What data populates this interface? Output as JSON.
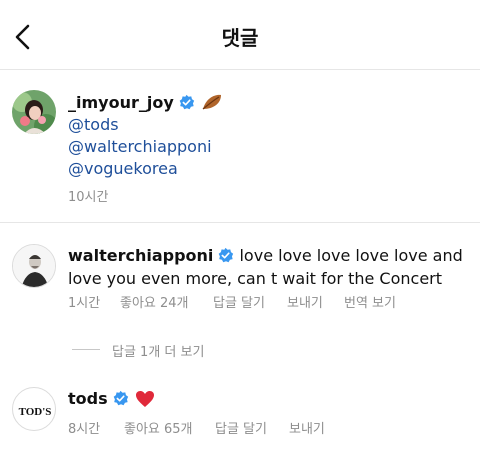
{
  "header": {
    "title": "댓글"
  },
  "caption": {
    "username": "_imyour_joy",
    "mentions": [
      "@tods",
      "@walterchiapponi",
      "@voguekorea"
    ],
    "time": "10시간"
  },
  "comments": [
    {
      "username": "walterchiapponi",
      "text": "love love love love love and love you even more, can t wait for the Concert",
      "time": "1시간",
      "likes": "좋아요 24개",
      "reply": "답글 달기",
      "send": "보내기",
      "translate": "번역 보기",
      "view_replies": "답글 1개 더 보기"
    },
    {
      "username": "tods",
      "avatar_logo": "TOD'S",
      "time": "8시간",
      "likes": "좋아요 65개",
      "reply": "답글 달기",
      "send": "보내기"
    }
  ],
  "icons": {
    "verified_color": "#3897f0",
    "heart_color": "#e0293a",
    "mention_color": "#1f4f9a"
  }
}
